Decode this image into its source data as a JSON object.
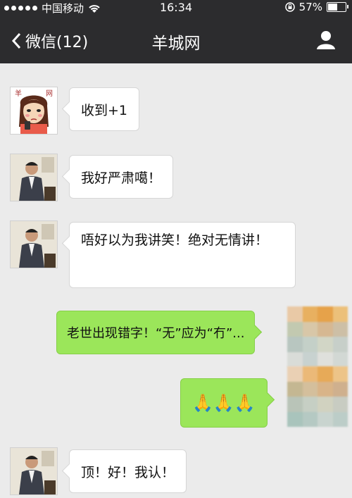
{
  "status_bar": {
    "carrier": "中国移动",
    "time": "16:34",
    "battery": "57%"
  },
  "nav": {
    "back_label": "微信(12)",
    "title": "羊城网"
  },
  "messages": [
    {
      "side": "left",
      "text": "收到+1",
      "avatar": "cartoon-girl-avatar"
    },
    {
      "side": "left",
      "text": "我好严肃噶！",
      "avatar": "man-photo-avatar"
    },
    {
      "side": "left",
      "text": "唔好以为我讲笑！绝对无情讲！",
      "avatar": "man-photo-avatar"
    },
    {
      "side": "right",
      "text": "老世出现错字！“无”应为“冇”...",
      "avatar": "blurred-avatar"
    },
    {
      "side": "right",
      "text": "🙏🙏🙏",
      "avatar": "blurred-avatar"
    },
    {
      "side": "left",
      "text": "顶！好！我认！",
      "avatar": "man-photo-avatar"
    }
  ],
  "colors": {
    "header": "#2c2c2e",
    "background": "#ebebeb",
    "sent_bubble": "#9be65a",
    "received_bubble": "#ffffff"
  }
}
